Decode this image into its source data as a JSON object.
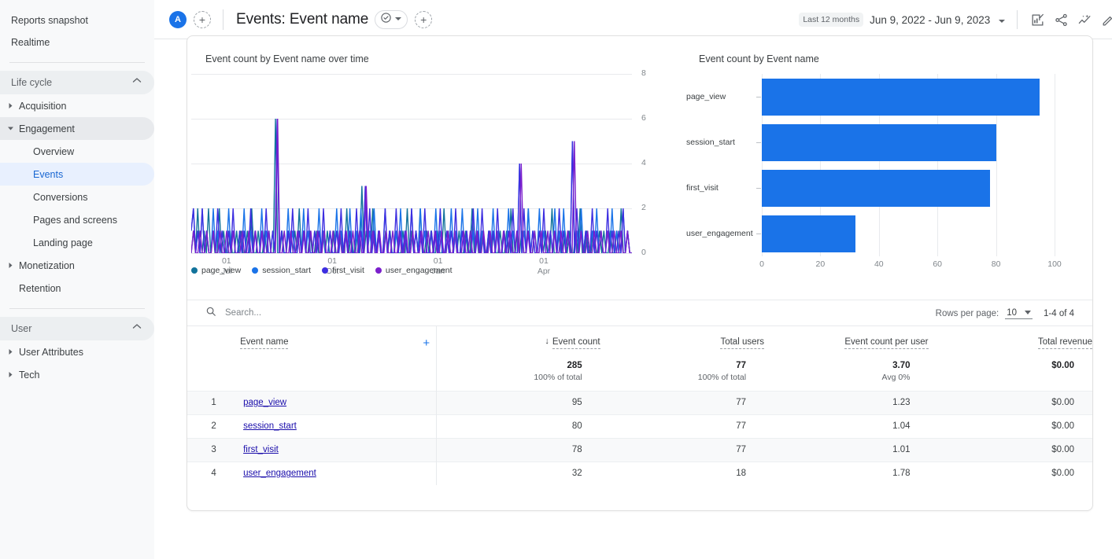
{
  "sidebar": {
    "top_items": [
      {
        "label": "Reports snapshot",
        "name": "reports-snapshot"
      },
      {
        "label": "Realtime",
        "name": "realtime"
      }
    ],
    "sections": [
      {
        "title": "Life cycle",
        "groups": [
          {
            "label": "Acquisition",
            "expandable": true,
            "expanded": false,
            "children": []
          },
          {
            "label": "Engagement",
            "expandable": true,
            "expanded": true,
            "children": [
              {
                "label": "Overview",
                "selected": false
              },
              {
                "label": "Events",
                "selected": true
              },
              {
                "label": "Conversions",
                "selected": false
              },
              {
                "label": "Pages and screens",
                "selected": false
              },
              {
                "label": "Landing page",
                "selected": false
              }
            ]
          },
          {
            "label": "Monetization",
            "expandable": true,
            "expanded": false,
            "children": []
          },
          {
            "label": "Retention",
            "expandable": false,
            "expanded": false,
            "children": []
          }
        ]
      },
      {
        "title": "User",
        "groups": [
          {
            "label": "User Attributes",
            "expandable": true,
            "expanded": false,
            "children": []
          },
          {
            "label": "Tech",
            "expandable": true,
            "expanded": false,
            "children": []
          }
        ]
      }
    ]
  },
  "topbar": {
    "account_initial": "A",
    "add_comparison_label": "+",
    "title": "Events: Event name",
    "title_chip_icon": "check-circle-icon",
    "title_chip_caret": "chevron-down-icon",
    "add_segment_label": "+",
    "date_pill": "Last 12 months",
    "date_range": "Jun 9, 2022 - Jun 9, 2023",
    "date_caret": "chevron-down-icon",
    "actions": [
      {
        "name": "customize-report-icon",
        "title": "Customize report"
      },
      {
        "name": "share-icon",
        "title": "Share this report"
      },
      {
        "name": "insights-icon",
        "title": "Insights"
      },
      {
        "name": "edit-icon",
        "title": "Edit"
      }
    ]
  },
  "charts": {
    "timeseries_title": "Event count by Event name over time",
    "bar_title": "Event count by Event name",
    "legend": [
      {
        "label": "page_view",
        "color": "#12739b"
      },
      {
        "label": "session_start",
        "color": "#1a73e8"
      },
      {
        "label": "first_visit",
        "color": "#3d2ee0"
      },
      {
        "label": "user_engagement",
        "color": "#7b1fcc"
      }
    ]
  },
  "chart_data": [
    {
      "type": "line",
      "title": "Event count by Event name over time",
      "xlabel": "",
      "ylabel": "",
      "ylim": [
        0,
        8
      ],
      "yticks": [
        0,
        2,
        4,
        6,
        8
      ],
      "xticks": [
        {
          "label_top": "01",
          "label_bottom": "Jul",
          "pos_pct": 8.0
        },
        {
          "label_top": "01",
          "label_bottom": "Oct",
          "pos_pct": 32.0
        },
        {
          "label_top": "01",
          "label_bottom": "Jan",
          "pos_pct": 56.0
        },
        {
          "label_top": "01",
          "label_bottom": "Apr",
          "pos_pct": 80.0
        }
      ],
      "grid": true,
      "legend_position": "bottom-left",
      "series": [
        {
          "name": "page_view",
          "color": "#12739b",
          "values": [
            0,
            1,
            0,
            2,
            0,
            0,
            1,
            0,
            2,
            0,
            1,
            0,
            0,
            2,
            0,
            1,
            0,
            0,
            1,
            0,
            0,
            1,
            0,
            1,
            0,
            0,
            1,
            0,
            2,
            0,
            0,
            1,
            0,
            0,
            1,
            0,
            1,
            0,
            0,
            6,
            0,
            0,
            1,
            0,
            0,
            1,
            0,
            0,
            1,
            0,
            2,
            0,
            1,
            0,
            0,
            1,
            0,
            0,
            1,
            0,
            0,
            1,
            0,
            1,
            0,
            0,
            1,
            0,
            0,
            1,
            0,
            0,
            2,
            0,
            1,
            0,
            0,
            1,
            0,
            3,
            0,
            1,
            0,
            0,
            2,
            0,
            0,
            1,
            0,
            0,
            1,
            0,
            1,
            0,
            0,
            1,
            0,
            0,
            1,
            0,
            2,
            0,
            1,
            0,
            1,
            0,
            2,
            0,
            0,
            1,
            0,
            1,
            0,
            0,
            1,
            0,
            0,
            2,
            0,
            1,
            0,
            0,
            1,
            0,
            1,
            0,
            0,
            1,
            0,
            0,
            2,
            0,
            1,
            0,
            0,
            1,
            0,
            0,
            1,
            0,
            1,
            0,
            0,
            1,
            0,
            0,
            1,
            0,
            2,
            0,
            0,
            1,
            0,
            1,
            0,
            0,
            2,
            0,
            0,
            1,
            0,
            0,
            1,
            0,
            1,
            0,
            0,
            2,
            0,
            0,
            1,
            0,
            0,
            1,
            0,
            1,
            0,
            0,
            1,
            0,
            2,
            0,
            0,
            1,
            0,
            0,
            1,
            0,
            0,
            1,
            0,
            1,
            0,
            0,
            1,
            0,
            0,
            1,
            0,
            2,
            0,
            0,
            1,
            0,
            0
          ]
        },
        {
          "name": "session_start",
          "color": "#1a73e8",
          "values": [
            1,
            2,
            0,
            1,
            0,
            2,
            0,
            1,
            0,
            0,
            2,
            0,
            1,
            0,
            1,
            0,
            0,
            2,
            0,
            1,
            0,
            0,
            1,
            0,
            2,
            0,
            0,
            1,
            0,
            1,
            0,
            0,
            2,
            0,
            1,
            0,
            0,
            1,
            0,
            6,
            0,
            1,
            0,
            0,
            2,
            0,
            1,
            0,
            0,
            1,
            0,
            2,
            0,
            1,
            0,
            0,
            1,
            0,
            2,
            0,
            1,
            0,
            0,
            1,
            0,
            0,
            2,
            0,
            1,
            0,
            1,
            0,
            2,
            0,
            0,
            1,
            0,
            2,
            0,
            3,
            0,
            1,
            0,
            2,
            0,
            1,
            0,
            0,
            2,
            0,
            1,
            0,
            0,
            1,
            0,
            2,
            0,
            1,
            0,
            0,
            2,
            0,
            1,
            0,
            2,
            0,
            1,
            0,
            0,
            1,
            0,
            2,
            0,
            1,
            0,
            0,
            1,
            0,
            2,
            0,
            1,
            0,
            0,
            2,
            0,
            1,
            0,
            0,
            1,
            0,
            2,
            0,
            1,
            0,
            0,
            1,
            0,
            2,
            0,
            1,
            0,
            0,
            1,
            0,
            2,
            0,
            1,
            0,
            0,
            4,
            0,
            1,
            0,
            2,
            0,
            1,
            0,
            0,
            2,
            0,
            1,
            0,
            0,
            1,
            0,
            2,
            0,
            1,
            0,
            2,
            0,
            1,
            0,
            5,
            0,
            1,
            0,
            2,
            0,
            1,
            0,
            0,
            1,
            0,
            2,
            0,
            1,
            0,
            0,
            1,
            0,
            2,
            0,
            1,
            0,
            0,
            2,
            0,
            1,
            0,
            0
          ]
        },
        {
          "name": "first_visit",
          "color": "#3d2ee0",
          "values": [
            1,
            2,
            0,
            1,
            0,
            2,
            0,
            1,
            0,
            0,
            1,
            0,
            2,
            0,
            1,
            0,
            0,
            1,
            0,
            2,
            0,
            0,
            1,
            0,
            1,
            0,
            0,
            2,
            0,
            1,
            0,
            0,
            1,
            0,
            2,
            0,
            0,
            1,
            0,
            6,
            0,
            1,
            0,
            0,
            1,
            0,
            2,
            0,
            0,
            1,
            0,
            1,
            0,
            2,
            0,
            0,
            1,
            0,
            1,
            0,
            2,
            0,
            0,
            1,
            0,
            0,
            1,
            0,
            2,
            0,
            1,
            0,
            1,
            0,
            0,
            2,
            0,
            1,
            0,
            3,
            0,
            2,
            0,
            1,
            0,
            1,
            0,
            0,
            2,
            0,
            1,
            0,
            0,
            2,
            0,
            1,
            0,
            1,
            0,
            0,
            2,
            0,
            1,
            0,
            1,
            0,
            2,
            0,
            0,
            1,
            0,
            1,
            0,
            2,
            0,
            0,
            1,
            0,
            1,
            0,
            2,
            0,
            0,
            1,
            0,
            1,
            0,
            0,
            2,
            0,
            1,
            0,
            2,
            0,
            0,
            1,
            0,
            1,
            0,
            2,
            0,
            0,
            1,
            0,
            1,
            0,
            2,
            0,
            0,
            4,
            0,
            2,
            0,
            1,
            0,
            1,
            0,
            0,
            1,
            0,
            2,
            0,
            0,
            1,
            0,
            1,
            0,
            2,
            0,
            1,
            0,
            1,
            0,
            5,
            0,
            2,
            0,
            1,
            0,
            1,
            0,
            0,
            2,
            0,
            1,
            0,
            1,
            0,
            0,
            2,
            0,
            1,
            0,
            0,
            1,
            0,
            2,
            0,
            1,
            0,
            0
          ]
        },
        {
          "name": "user_engagement",
          "color": "#7b1fcc",
          "values": [
            0,
            1,
            0,
            0,
            1,
            0,
            0,
            1,
            0,
            0,
            1,
            0,
            0,
            1,
            0,
            0,
            1,
            0,
            0,
            1,
            0,
            0,
            0,
            1,
            0,
            0,
            1,
            0,
            0,
            1,
            0,
            0,
            1,
            0,
            0,
            1,
            0,
            0,
            0,
            6,
            0,
            0,
            1,
            0,
            0,
            1,
            0,
            0,
            1,
            0,
            0,
            1,
            0,
            0,
            1,
            0,
            0,
            1,
            0,
            0,
            1,
            0,
            0,
            0,
            1,
            0,
            0,
            1,
            0,
            0,
            1,
            0,
            0,
            1,
            0,
            0,
            1,
            0,
            0,
            3,
            0,
            0,
            1,
            0,
            0,
            1,
            0,
            0,
            1,
            0,
            0,
            1,
            0,
            0,
            1,
            0,
            0,
            1,
            0,
            0,
            1,
            0,
            0,
            0,
            1,
            0,
            0,
            1,
            0,
            0,
            1,
            0,
            0,
            1,
            0,
            0,
            1,
            0,
            0,
            1,
            0,
            0,
            0,
            1,
            0,
            0,
            1,
            0,
            0,
            1,
            0,
            0,
            1,
            0,
            0,
            1,
            0,
            0,
            1,
            0,
            0,
            1,
            0,
            0,
            1,
            0,
            0,
            1,
            0,
            4,
            0,
            0,
            1,
            0,
            0,
            1,
            0,
            0,
            1,
            0,
            0,
            1,
            0,
            0,
            1,
            0,
            0,
            1,
            0,
            0,
            1,
            0,
            0,
            5,
            0,
            0,
            1,
            0,
            0,
            1,
            0,
            0,
            1,
            0,
            0,
            1,
            0,
            0,
            1,
            0,
            0,
            1,
            0,
            0,
            1,
            0,
            0,
            1,
            0,
            0
          ]
        }
      ]
    },
    {
      "type": "bar",
      "orientation": "horizontal",
      "title": "Event count by Event name",
      "categories": [
        "page_view",
        "session_start",
        "first_visit",
        "user_engagement"
      ],
      "values": [
        95,
        80,
        78,
        32
      ],
      "xlabel": "",
      "ylabel": "",
      "xlim": [
        0,
        100
      ],
      "xticks": [
        0,
        20,
        40,
        60,
        80,
        100
      ],
      "bar_color": "#1a73e8",
      "grid": true,
      "legend_position": "none"
    }
  ],
  "table": {
    "search_placeholder": "Search...",
    "search_value": "",
    "rows_per_page_label": "Rows per page:",
    "rows_per_page_value": "10",
    "range_text": "1-4 of 4",
    "columns": [
      {
        "key": "idx",
        "label": "",
        "align": "center"
      },
      {
        "key": "name",
        "label": "Event name",
        "align": "left",
        "sorted": false
      },
      {
        "key": "event_count",
        "label": "Event count",
        "align": "right",
        "sorted": true,
        "sort_dir": "desc"
      },
      {
        "key": "total_users",
        "label": "Total users",
        "align": "right",
        "sorted": false
      },
      {
        "key": "event_count_per_user",
        "label": "Event count per user",
        "align": "right",
        "sorted": false
      },
      {
        "key": "total_revenue",
        "label": "Total revenue",
        "align": "right",
        "sorted": false
      }
    ],
    "add_dimension_label": "+",
    "totals": [
      {
        "main": "285",
        "sub": "100% of total"
      },
      {
        "main": "77",
        "sub": "100% of total"
      },
      {
        "main": "3.70",
        "sub": "Avg 0%"
      },
      {
        "main": "$0.00",
        "sub": ""
      }
    ],
    "rows": [
      {
        "idx": "1",
        "name": "page_view",
        "event_count": "95",
        "total_users": "77",
        "event_count_per_user": "1.23",
        "total_revenue": "$0.00"
      },
      {
        "idx": "2",
        "name": "session_start",
        "event_count": "80",
        "total_users": "77",
        "event_count_per_user": "1.04",
        "total_revenue": "$0.00"
      },
      {
        "idx": "3",
        "name": "first_visit",
        "event_count": "78",
        "total_users": "77",
        "event_count_per_user": "1.01",
        "total_revenue": "$0.00"
      },
      {
        "idx": "4",
        "name": "user_engagement",
        "event_count": "32",
        "total_users": "18",
        "event_count_per_user": "1.78",
        "total_revenue": "$0.00"
      }
    ]
  }
}
